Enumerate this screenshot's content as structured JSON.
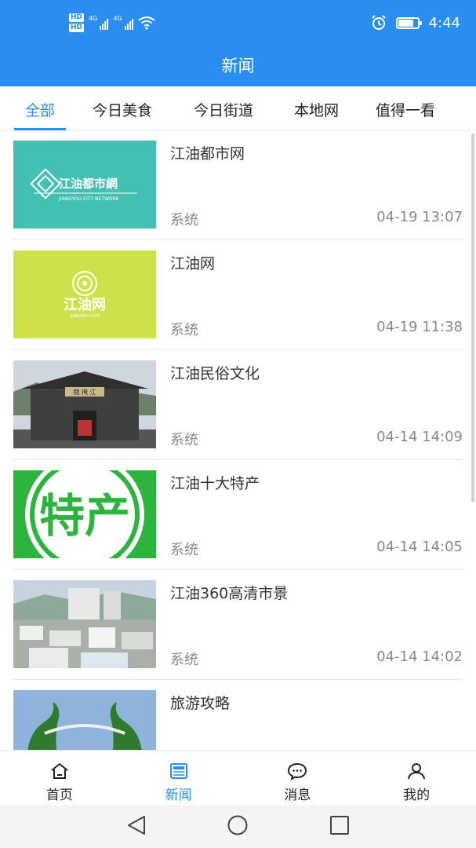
{
  "status_bar": {
    "hd1": "HD",
    "hd2": "HD",
    "net1": "4G",
    "net2": "4G",
    "time": "4:44",
    "battery_level": 0.8
  },
  "header": {
    "title": "新闻"
  },
  "tabs": [
    {
      "label": "全部",
      "active": true
    },
    {
      "label": "今日美食",
      "active": false
    },
    {
      "label": "今日街道",
      "active": false
    },
    {
      "label": "本地网",
      "active": false
    },
    {
      "label": "值得一看",
      "active": false
    }
  ],
  "news": [
    {
      "title": "江油都市网",
      "source": "系统",
      "time": "04-19 13:07",
      "thumb_text": "江油都市網",
      "thumb_sub": "JIANGYOU CITY NETWORK",
      "thumb_color": "#43bfb4"
    },
    {
      "title": "江油网",
      "source": "系统",
      "time": "04-19 11:38",
      "thumb_text": "江油网",
      "thumb_sub": "JIANGYOU.COM",
      "thumb_color": "#cfe14a"
    },
    {
      "title": "江油民俗文化",
      "source": "系统",
      "time": "04-14 14:09",
      "thumb_text": "龍 掩 江",
      "thumb_color": "#4b4b4b"
    },
    {
      "title": "江油十大特产",
      "source": "系统",
      "time": "04-14 14:05",
      "thumb_text": "特产",
      "thumb_color": "#2db43f"
    },
    {
      "title": "江油360高清市景",
      "source": "系统",
      "time": "04-14 14:02",
      "thumb_color": "#b9c7d3"
    },
    {
      "title": "旅游攻略",
      "source": "",
      "time": "",
      "thumb_color": "#3a8c3a"
    }
  ],
  "bottom_nav": [
    {
      "label": "首页",
      "icon": "home-icon",
      "active": false
    },
    {
      "label": "新闻",
      "icon": "news-icon",
      "active": true
    },
    {
      "label": "消息",
      "icon": "message-icon",
      "active": false
    },
    {
      "label": "我的",
      "icon": "person-icon",
      "active": false
    }
  ],
  "colors": {
    "primary": "#2a8ef0",
    "text": "#333333",
    "muted": "#888888"
  }
}
